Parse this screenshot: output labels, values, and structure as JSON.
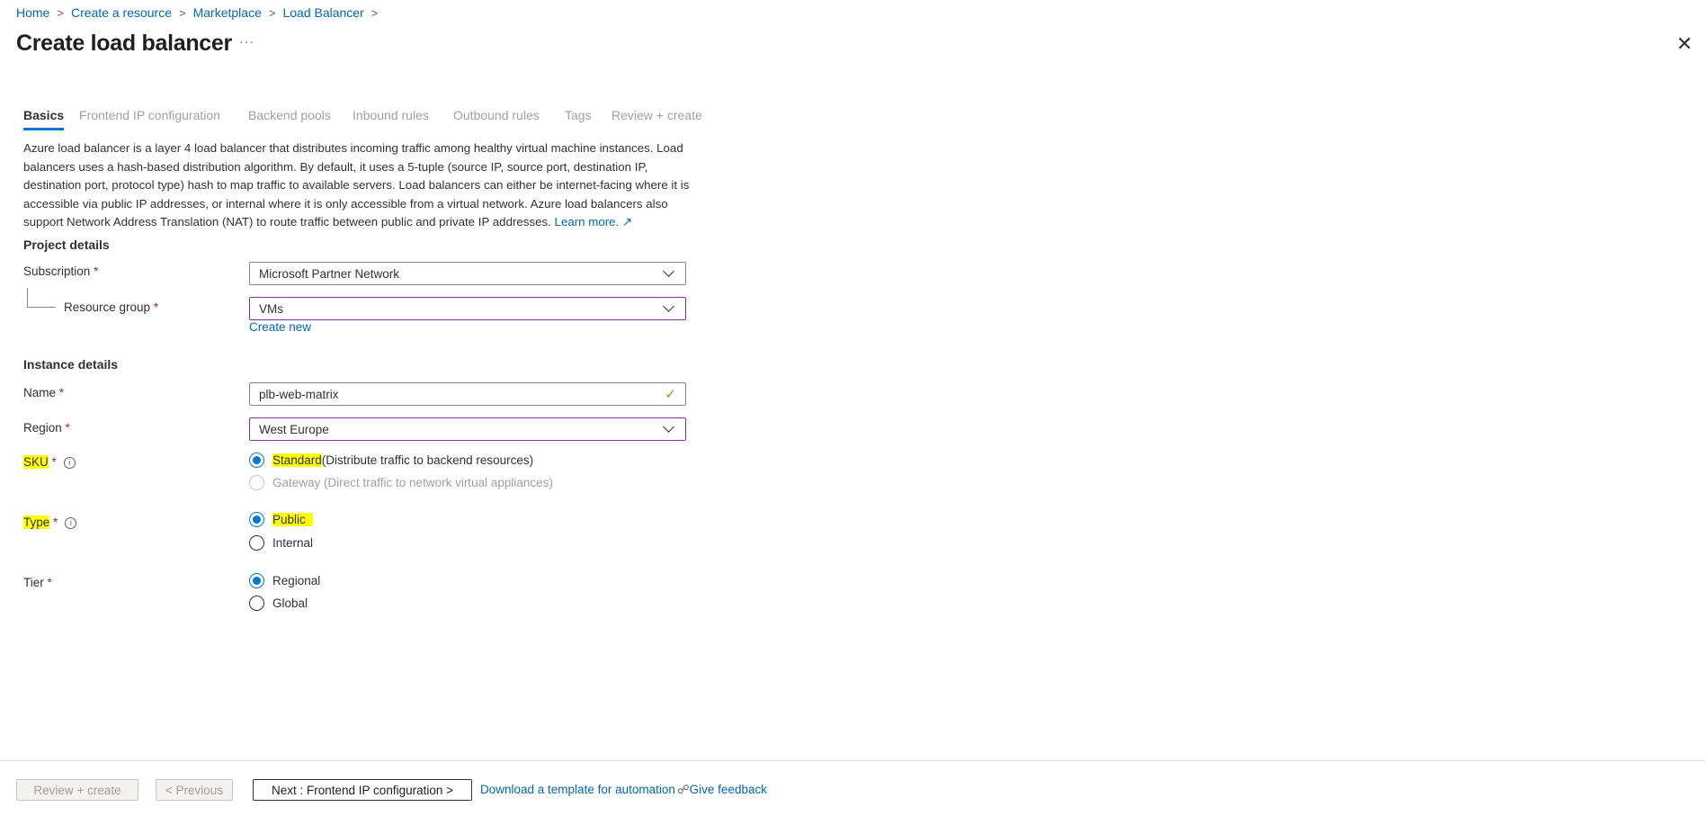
{
  "breadcrumb": [
    "Home",
    "Create a resource",
    "Marketplace",
    "Load Balancer"
  ],
  "title": "Create load balancer",
  "more": "···",
  "close": "✕",
  "tabs": [
    "Basics",
    "Frontend IP configuration",
    "Backend pools",
    "Inbound rules",
    "Outbound rules",
    "Tags",
    "Review + create"
  ],
  "description": "Azure load balancer is a layer 4 load balancer that distributes incoming traffic among healthy virtual machine instances. Load balancers uses a hash-based distribution algorithm. By default, it uses a 5-tuple (source IP, source port, destination IP, destination port, protocol type) hash to map traffic to available servers. Load balancers can either be internet-facing where it is accessible via public IP addresses, or internal where it is only accessible from a virtual network. Azure load balancers also support Network Address Translation (NAT) to route traffic between public and private IP addresses.",
  "learn_more": "Learn more. ↗",
  "project": {
    "heading": "Project details",
    "subscription_label": "Subscription",
    "subscription": "Microsoft Partner Network",
    "rg_label": "Resource group",
    "rg": "VMs",
    "create_new": "Create new"
  },
  "instance": {
    "heading": "Instance details",
    "name_label": "Name",
    "name": "plb-web-matrix",
    "region_label": "Region",
    "region": "West Europe",
    "sku_label": "SKU",
    "sku_options": [
      {
        "hl": "Standard",
        "rest": " (Distribute traffic to backend resources)"
      },
      {
        "label": "Gateway (Direct traffic to network virtual appliances)"
      }
    ],
    "type_label": "Type",
    "type_options": [
      "Public",
      "Internal"
    ],
    "tier_label": "Tier",
    "tier_options": [
      "Regional",
      "Global"
    ]
  },
  "required": "*",
  "info": "i",
  "footer": {
    "review": "Review + create",
    "previous": "< Previous",
    "next": "Next : Frontend IP configuration >",
    "download": "Download a template for automation",
    "feedback": "Give feedback",
    "feedback_icon": "☍"
  }
}
